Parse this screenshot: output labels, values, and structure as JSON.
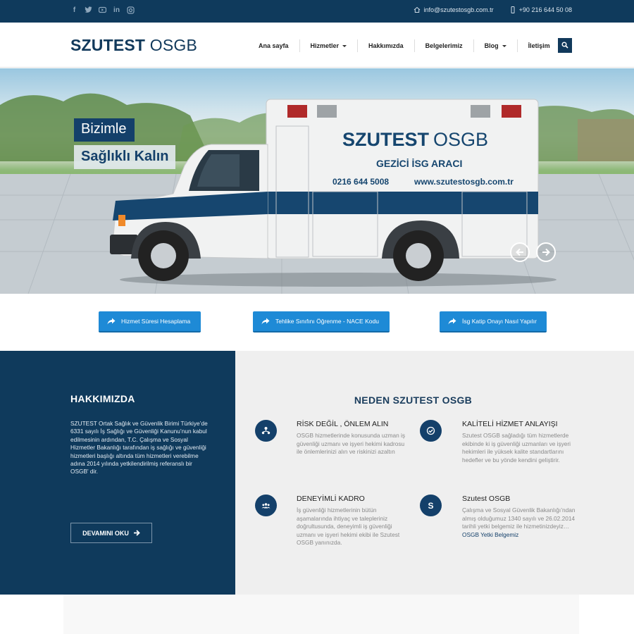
{
  "topbar": {
    "social_icons": [
      "facebook-icon",
      "twitter-icon",
      "youtube-icon",
      "linkedin-icon",
      "instagram-icon"
    ],
    "email": "info@szutestosgb.com.tr",
    "phone": "+90 216 644 50 08"
  },
  "header": {
    "logo_bold": "SZUTEST",
    "logo_light": "OSGB",
    "nav": [
      {
        "label": "Ana sayfa",
        "dropdown": false
      },
      {
        "label": "Hizmetler",
        "dropdown": true
      },
      {
        "label": "Hakkımızda",
        "dropdown": false
      },
      {
        "label": "Belgelerimiz",
        "dropdown": false
      },
      {
        "label": "Blog",
        "dropdown": true
      },
      {
        "label": "İletişim",
        "dropdown": false
      }
    ]
  },
  "hero": {
    "line1": "Bizimle",
    "line2": "Sağlıklı Kalın",
    "vehicle": {
      "brand_bold": "SZUTEST",
      "brand_light": "OSGB",
      "subtitle": "GEZİCİ İSG ARACI",
      "phone": "0216 644 5008",
      "website": "www.szutestosgb.com.tr"
    }
  },
  "cta_buttons": [
    {
      "label": "Hizmet Süresi Hesaplama"
    },
    {
      "label": "Tehlike Sınıfını Öğrenme - NACE Kodu"
    },
    {
      "label": "İsg Katip Onayı Nasıl Yapılır"
    }
  ],
  "about": {
    "title": "HAKKIMIZDA",
    "text": "SZUTEST Ortak Sağlık ve Güvenlik Birimi Türkiye’de 6331 sayılı İş Sağlığı ve Güvenliği Kanunu’nun kabul edilmesinin ardından, T.C. Çalışma ve Sosyal Hizmetler Bakanlığı tarafından iş sağlığı ve güvenliği hizmetleri başlığı altında tüm hizmetleri verebilme adına 2014 yılında yetkilendirilmiş referanslı bir OSGB' dir.",
    "more_label": "DEVAMINI OKU"
  },
  "why": {
    "title": "NEDEN SZUTEST OSGB",
    "features": [
      {
        "icon": "users-hierarchy-icon",
        "title": "RİSK DEĞİL , ÖNLEM ALIN",
        "text": "OSGB hizmetlerinde konusunda uzman iş güvenliği uzmanı ve işyeri hekimi kadrosu ile önlemlerinizi alın ve riskinizi azaltın",
        "link": ""
      },
      {
        "icon": "badge-check-icon",
        "title": "KALİTELİ HİZMET ANLAYIŞI",
        "text": "Szutest OSGB sağladığı tüm hizmetlerde ekibinde ki iş güvenliği uzmanları ve işyeri hekimleri ile yüksek kalite standartlarını hedefler ve bu yönde kendini geliştirir.",
        "link": ""
      },
      {
        "icon": "team-icon",
        "title": "DENEYİMLİ KADRO",
        "text": "İş güvenliği hizmetlerinin bütün aşamalarında ihtiyaç ve talepleriniz doğrultusunda, deneyimli iş güvenliği uzmanı ve işyeri hekimi ekibi ile Szutest OSGB yanınızda.",
        "link": ""
      },
      {
        "icon": "s-letter-icon",
        "title": "Szutest OSGB",
        "text": "Çalışma ve Sosyal Güvenlik Bakanlığı’ndan almış olduğumuz 1340 sayılı ve 26.02.2014 tarihli yetki belgemiz ile hizmetinizdeyiz…",
        "link": "OSGB Yetki Belgemiz"
      }
    ]
  },
  "colors": {
    "primary": "#0f3a5c",
    "accent": "#1e8ad6",
    "panel": "#efefef"
  }
}
